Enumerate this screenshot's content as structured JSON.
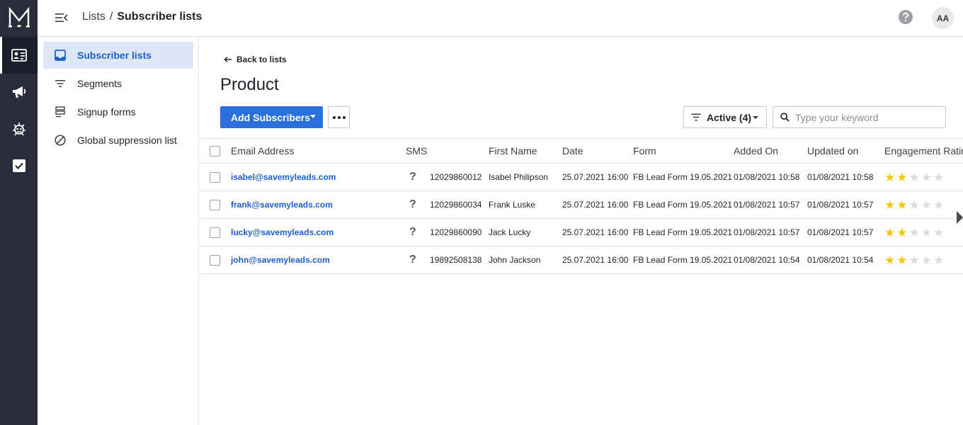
{
  "topbar": {
    "breadcrumb_parent": "Lists",
    "breadcrumb_sep": "/",
    "breadcrumb_current": "Subscriber lists",
    "avatar_initials": "AA"
  },
  "rail": {
    "icons": [
      "logo-icon",
      "contacts-icon",
      "campaigns-icon",
      "automation-icon",
      "tasks-icon"
    ]
  },
  "subnav": {
    "items": [
      {
        "label": "Subscriber lists",
        "icon": "inbox-icon",
        "active": true
      },
      {
        "label": "Segments",
        "icon": "filter-icon"
      },
      {
        "label": "Signup forms",
        "icon": "form-icon"
      },
      {
        "label": "Global suppression list",
        "icon": "block-icon"
      }
    ]
  },
  "main": {
    "back_label": "Back to lists",
    "title": "Product",
    "add_button": "Add Subscribers",
    "filter_label": "Active (4)",
    "search_placeholder": "Type your keyword"
  },
  "table": {
    "columns": [
      "Email Address",
      "SMS",
      "First Name",
      "Date",
      "Form",
      "Added On",
      "Updated on",
      "Engagement Rating"
    ],
    "rows": [
      {
        "email": "isabel@savemyleads.com",
        "sms": "?",
        "phone": "12029860012",
        "first_name": "Isabel Philipson",
        "date": "25.07.2021 16:00",
        "form": "FB Lead Form 19.05.2021",
        "added": "01/08/2021 10:58",
        "updated": "01/08/2021 10:58",
        "rating": 2
      },
      {
        "email": "frank@savemyleads.com",
        "sms": "?",
        "phone": "12029860034",
        "first_name": "Frank Luske",
        "date": "25.07.2021 16:00",
        "form": "FB Lead Form 19.05.2021",
        "added": "01/08/2021 10:57",
        "updated": "01/08/2021 10:57",
        "rating": 2
      },
      {
        "email": "lucky@savemyleads.com",
        "sms": "?",
        "phone": "12029860090",
        "first_name": "Jack Lucky",
        "date": "25.07.2021 16:00",
        "form": "FB Lead Form 19.05.2021",
        "added": "01/08/2021 10:57",
        "updated": "01/08/2021 10:57",
        "rating": 2
      },
      {
        "email": "john@savemyleads.com",
        "sms": "?",
        "phone": "19892508138",
        "first_name": "John Jackson",
        "date": "25.07.2021 16:00",
        "form": "FB Lead Form 19.05.2021",
        "added": "01/08/2021 10:54",
        "updated": "01/08/2021 10:54",
        "rating": 2
      }
    ],
    "rating_max": 5
  },
  "colors": {
    "rail_bg": "#2b2c3b",
    "accent": "#2a6fdb",
    "link": "#1e5fc9",
    "active_nav_bg": "#dde7f7",
    "star_on": "#f2c811",
    "star_off": "#d9dbde"
  }
}
